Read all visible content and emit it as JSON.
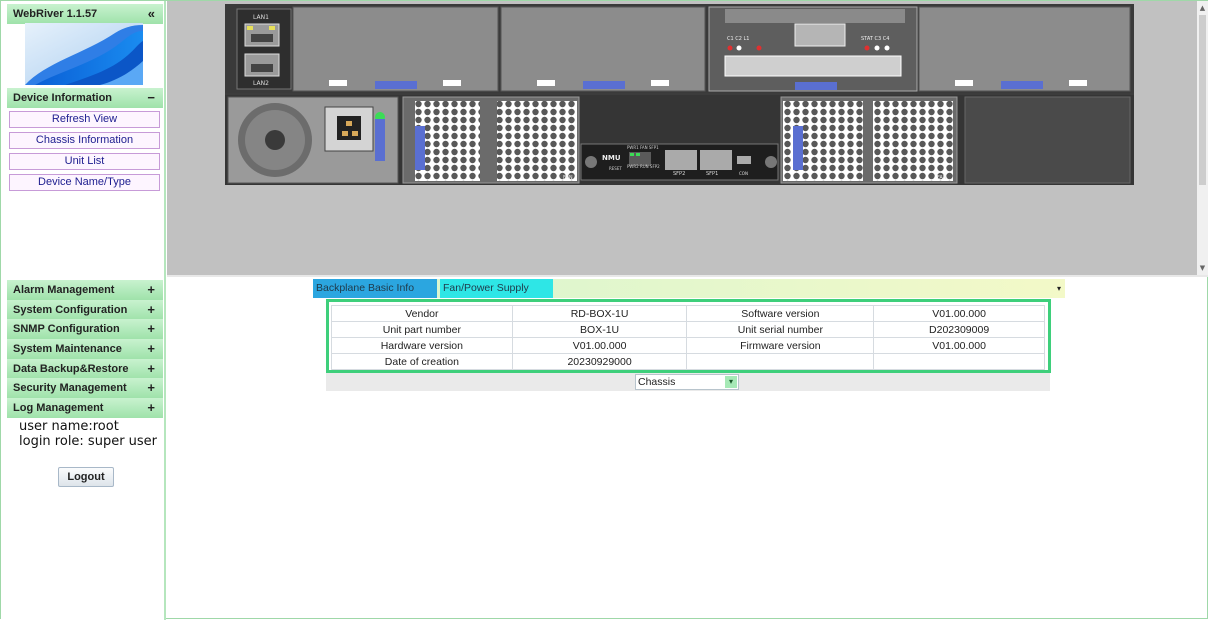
{
  "sidebar": {
    "app_title": "WebRiver 1.1.57",
    "collapse_glyph": "«",
    "device_info": {
      "label": "Device Information",
      "toggle": "−",
      "links": [
        "Refresh View",
        "Chassis Information",
        "Unit List",
        "Device Name/Type"
      ]
    },
    "groups": [
      {
        "label": "Alarm Management",
        "toggle": "+"
      },
      {
        "label": "System Configuration",
        "toggle": "+"
      },
      {
        "label": "SNMP Configuration",
        "toggle": "+"
      },
      {
        "label": "System Maintenance",
        "toggle": "+"
      },
      {
        "label": "Data Backup&Restore",
        "toggle": "+"
      },
      {
        "label": "Security Management",
        "toggle": "+"
      },
      {
        "label": "Log Management",
        "toggle": "+"
      }
    ],
    "user_line": "user name:root",
    "role_line": "login role:  super user",
    "logout_label": "Logout"
  },
  "chassis_labels": {
    "lan1": "LAN1",
    "lan2": "LAN2",
    "nmu": "NMU",
    "reset": "RESET",
    "sfp2": "SFP2",
    "sfp1": "SFP1",
    "con": "CON",
    "fan": "FAN",
    "stat_leds": "STAT C3 C4",
    "left_leds": "C1 C2  L1",
    "nmu_leds_top": "PWR1 FAN SFP1",
    "nmu_leds_bottom": "PWR2 RUN SFP2"
  },
  "tabs": {
    "active": "Backplane Basic Info",
    "second": "Fan/Power Supply",
    "dropdown_glyph": "▾"
  },
  "info_table": [
    {
      "k1": "Vendor",
      "v1": "RD-BOX-1U",
      "k2": "Software version",
      "v2": "V01.00.000"
    },
    {
      "k1": "Unit part number",
      "v1": "BOX-1U",
      "k2": "Unit serial number",
      "v2": "D202309009"
    },
    {
      "k1": "Hardware version",
      "v1": "V01.00.000",
      "k2": "Firmware version",
      "v2": "V01.00.000"
    },
    {
      "k1": "Date of creation",
      "v1": "20230929000",
      "k2": "",
      "v2": ""
    }
  ],
  "selector": {
    "value": "Chassis",
    "glyph": "▾"
  },
  "colors": {
    "sidebar_header": "#9fe2aa",
    "active_tab": "#2ba6e0",
    "second_tab": "#2ee6e6",
    "highlight_frame": "#3ecf7b"
  }
}
